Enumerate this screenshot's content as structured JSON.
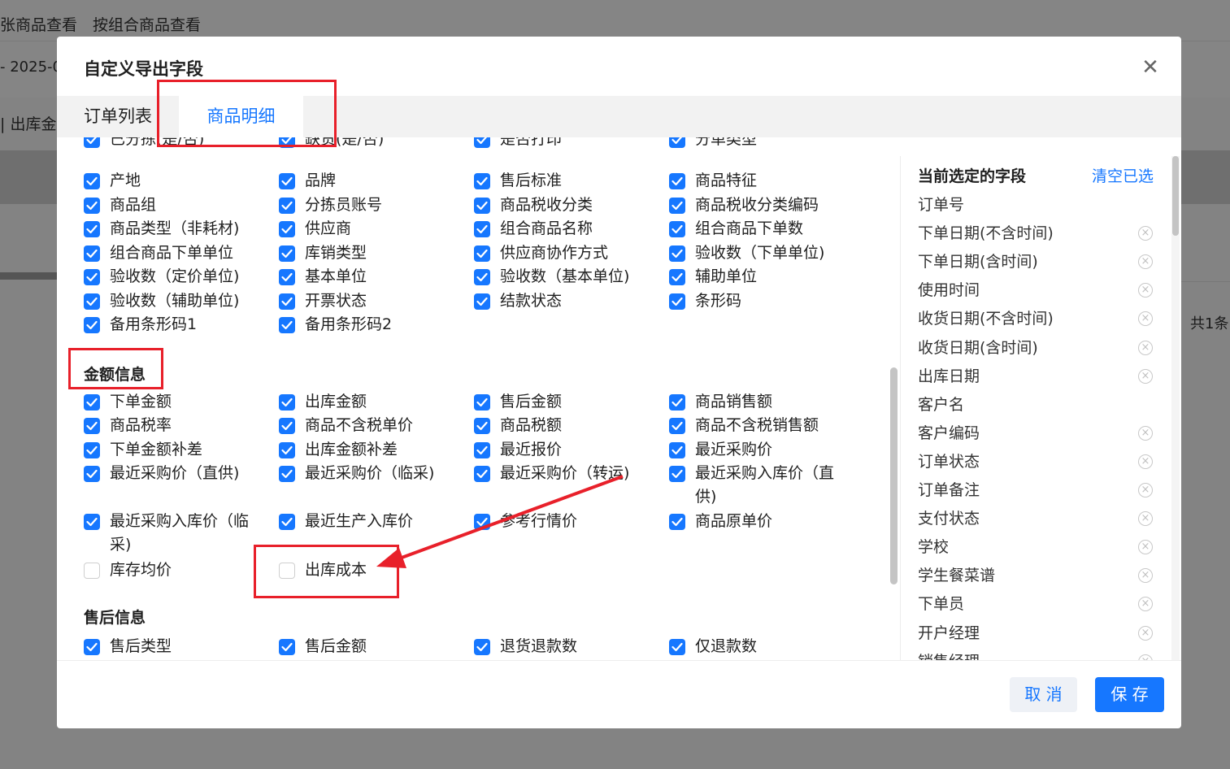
{
  "background": {
    "tabs": [
      "张商品查看",
      "按组合商品查看"
    ],
    "date_text": "- 2025-0",
    "breadcrumb": "| 出库金",
    "count_text": "共1条"
  },
  "dialog": {
    "title": "自定义导出字段",
    "close_icon": "close-icon",
    "tabs": [
      {
        "label": "订单列表",
        "active": false
      },
      {
        "label": "商品明细",
        "active": true
      }
    ],
    "partial_row": [
      "已分拣(是/否)",
      "缺货(是/否)",
      "是否打印",
      "分单类型"
    ],
    "basic_fields": [
      [
        "产地",
        "品牌",
        "售后标准",
        "商品特征"
      ],
      [
        "商品组",
        "分拣员账号",
        "商品税收分类",
        "商品税收分类编码"
      ],
      [
        "商品类型（非耗材)",
        "供应商",
        "组合商品名称",
        "组合商品下单数"
      ],
      [
        "组合商品下单单位",
        "库销类型",
        "供应商协作方式",
        "验收数（下单单位)"
      ],
      [
        "验收数（定价单位)",
        "基本单位",
        "验收数（基本单位)",
        "辅助单位"
      ],
      [
        "验收数（辅助单位)",
        "开票状态",
        "结款状态",
        "条形码"
      ],
      [
        "备用条形码1",
        "备用条形码2"
      ]
    ],
    "amount_section": {
      "title": "金额信息",
      "rows": [
        [
          "下单金额",
          "出库金额",
          "售后金额",
          "商品销售额"
        ],
        [
          "商品税率",
          "商品不含税单价",
          "商品税额",
          "商品不含税销售额"
        ],
        [
          "下单金额补差",
          "出库金额补差",
          "最近报价",
          "最近采购价"
        ],
        [
          "最近采购价（直供)",
          "最近采购价（临采)",
          "最近采购价（转运)",
          "最近采购入库价（直供)"
        ],
        [
          "最近采购入库价（临采)",
          "最近生产入库价",
          "参考行情价",
          "商品原单价"
        ],
        [
          "库存均价",
          "出库成本"
        ]
      ],
      "unchecked": [
        "库存均价",
        "出库成本"
      ]
    },
    "aftersale_section": {
      "title": "售后信息",
      "rows": [
        [
          "售后类型",
          "售后金额",
          "退货退款数",
          "仅退款数"
        ]
      ]
    },
    "selected_panel": {
      "title": "当前选定的字段",
      "clear_label": "清空已选",
      "remove_icon": "remove-circle-icon",
      "items": [
        {
          "label": "订单号",
          "removable": false
        },
        {
          "label": "下单日期(不含时间)",
          "removable": true
        },
        {
          "label": "下单日期(含时间)",
          "removable": true
        },
        {
          "label": "使用时间",
          "removable": true
        },
        {
          "label": "收货日期(不含时间)",
          "removable": true
        },
        {
          "label": "收货日期(含时间)",
          "removable": true
        },
        {
          "label": "出库日期",
          "removable": true
        },
        {
          "label": "客户名",
          "removable": false
        },
        {
          "label": "客户编码",
          "removable": true
        },
        {
          "label": "订单状态",
          "removable": true
        },
        {
          "label": "订单备注",
          "removable": true
        },
        {
          "label": "支付状态",
          "removable": true
        },
        {
          "label": "学校",
          "removable": true
        },
        {
          "label": "学生餐菜谱",
          "removable": true
        },
        {
          "label": "下单员",
          "removable": true
        },
        {
          "label": "开户经理",
          "removable": true
        },
        {
          "label": "销售经理",
          "removable": true
        }
      ]
    },
    "buttons": {
      "cancel": "取 消",
      "save": "保 存"
    }
  },
  "colors": {
    "accent": "#1677ff",
    "annotation": "#e8202a"
  }
}
